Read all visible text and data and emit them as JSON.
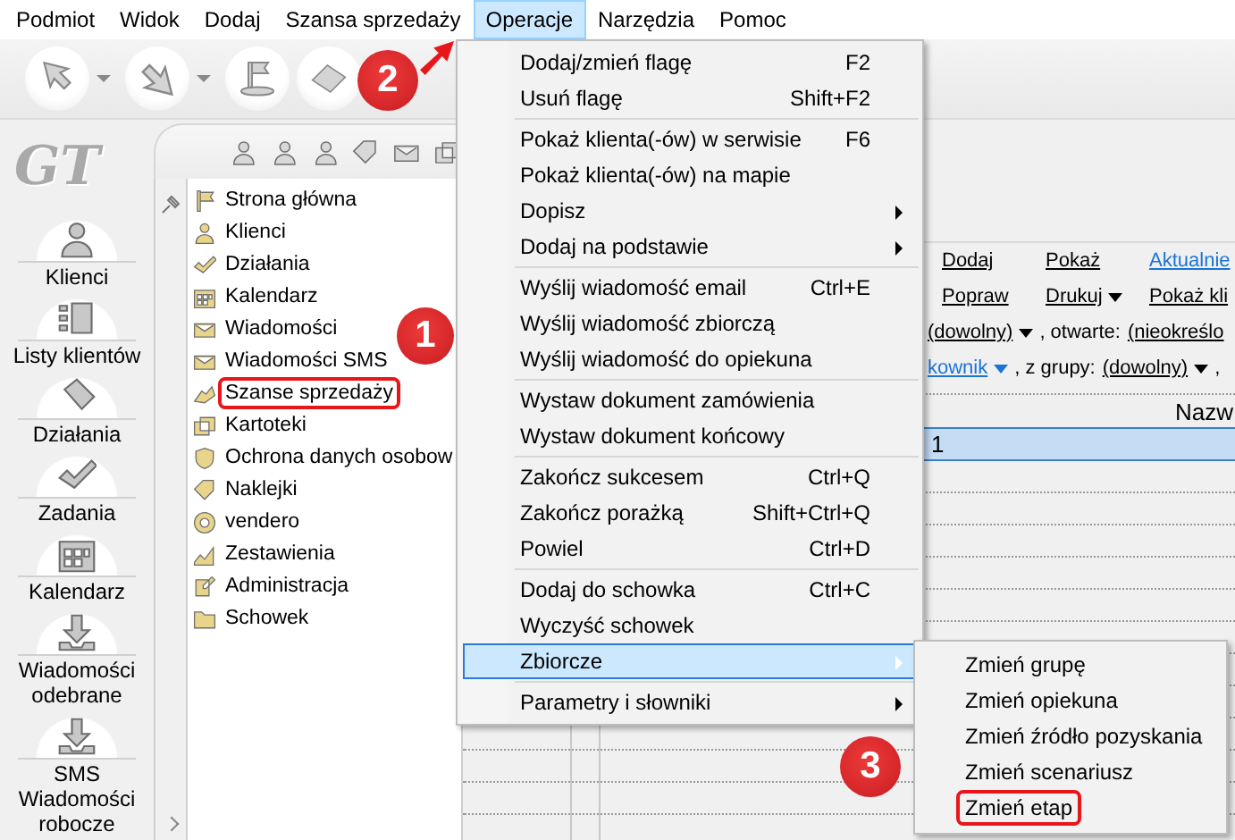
{
  "menubar": [
    {
      "label": "Podmiot",
      "selected": false
    },
    {
      "label": "Widok",
      "selected": false
    },
    {
      "label": "Dodaj",
      "selected": false
    },
    {
      "label": "Szansa sprzedaży",
      "selected": false
    },
    {
      "label": "Operacje",
      "selected": true
    },
    {
      "label": "Narzędzia",
      "selected": false
    },
    {
      "label": "Pomoc",
      "selected": false
    }
  ],
  "logo": "GT",
  "sidebar": [
    {
      "label": "Klienci"
    },
    {
      "label": "Listy klientów"
    },
    {
      "label": "Działania"
    },
    {
      "label": "Zadania"
    },
    {
      "label": "Kalendarz"
    },
    {
      "label": "Wiadomości odebrane"
    },
    {
      "label": "SMS Wiadomości robocze"
    }
  ],
  "tree": [
    {
      "label": "Strona główna",
      "marked": false
    },
    {
      "label": "Klienci",
      "marked": false
    },
    {
      "label": "Działania",
      "marked": false
    },
    {
      "label": "Kalendarz",
      "marked": false
    },
    {
      "label": "Wiadomości",
      "marked": false
    },
    {
      "label": "Wiadomości SMS",
      "marked": false
    },
    {
      "label": "Szanse sprzedaży",
      "marked": true
    },
    {
      "label": "Kartoteki",
      "marked": false
    },
    {
      "label": "Ochrona danych osobow",
      "marked": false
    },
    {
      "label": "Naklejki",
      "marked": false
    },
    {
      "label": "vendero",
      "marked": false
    },
    {
      "label": "Zestawienia",
      "marked": false
    },
    {
      "label": "Administracja",
      "marked": false
    },
    {
      "label": "Schowek",
      "marked": false
    }
  ],
  "content": {
    "rows": [
      [
        {
          "kind": "link",
          "label": "Dodaj"
        },
        {
          "kind": "link",
          "label": "Pokaż"
        },
        {
          "kind": "hyperlink",
          "label": "Aktualnie"
        }
      ],
      [
        {
          "kind": "link",
          "label": "Popraw"
        },
        {
          "kind": "dropdown",
          "label": "Drukuj"
        },
        {
          "kind": "link",
          "label": "Pokaż kli"
        }
      ],
      [
        {
          "kind": "dropdown",
          "label": "(dowolny)"
        },
        {
          "kind": "text",
          "label": ", otwarte:"
        },
        {
          "kind": "link",
          "label": "(nieokreślo"
        }
      ],
      [
        {
          "kind": "hyperdropdown",
          "label": "kownik"
        },
        {
          "kind": "text",
          "label": ", z grupy:"
        },
        {
          "kind": "dropdown",
          "label": "(dowolny)"
        },
        {
          "kind": "text",
          "label": ","
        }
      ]
    ],
    "table": {
      "header": "Nazw",
      "rows": [
        {
          "cell": "1",
          "selected": true
        }
      ]
    }
  },
  "menu": {
    "items": [
      {
        "kind": "item",
        "label": "Dodaj/zmień flagę",
        "shortcut": "F2",
        "submenu": false,
        "selected": false
      },
      {
        "kind": "item",
        "label": "Usuń flagę",
        "shortcut": "Shift+F2",
        "submenu": false,
        "selected": false
      },
      {
        "kind": "separator"
      },
      {
        "kind": "item",
        "label": "Pokaż klienta(-ów) w serwisie",
        "shortcut": "F6",
        "submenu": false,
        "selected": false
      },
      {
        "kind": "item",
        "label": "Pokaż klienta(-ów) na mapie",
        "submenu": false,
        "selected": false
      },
      {
        "kind": "item",
        "label": "Dopisz",
        "submenu": true,
        "selected": false
      },
      {
        "kind": "item",
        "label": "Dodaj na podstawie",
        "submenu": true,
        "selected": false
      },
      {
        "kind": "separator"
      },
      {
        "kind": "item",
        "label": "Wyślij wiadomość email",
        "shortcut": "Ctrl+E",
        "submenu": false,
        "selected": false
      },
      {
        "kind": "item",
        "label": "Wyślij wiadomość zbiorczą",
        "submenu": false,
        "selected": false
      },
      {
        "kind": "item",
        "label": "Wyślij wiadomość do opiekuna",
        "submenu": false,
        "selected": false
      },
      {
        "kind": "separator"
      },
      {
        "kind": "item",
        "label": "Wystaw dokument zamówienia",
        "submenu": false,
        "selected": false
      },
      {
        "kind": "item",
        "label": "Wystaw dokument końcowy",
        "submenu": false,
        "selected": false
      },
      {
        "kind": "separator"
      },
      {
        "kind": "item",
        "label": "Zakończ sukcesem",
        "shortcut": "Ctrl+Q",
        "submenu": false,
        "selected": false
      },
      {
        "kind": "item",
        "label": "Zakończ porażką",
        "shortcut": "Shift+Ctrl+Q",
        "submenu": false,
        "selected": false
      },
      {
        "kind": "item",
        "label": "Powiel",
        "shortcut": "Ctrl+D",
        "submenu": false,
        "selected": false
      },
      {
        "kind": "separator"
      },
      {
        "kind": "item",
        "label": "Dodaj do schowka",
        "shortcut": "Ctrl+C",
        "submenu": false,
        "selected": false
      },
      {
        "kind": "item",
        "label": "Wyczyść schowek",
        "submenu": false,
        "selected": false
      },
      {
        "kind": "item",
        "label": "Zbiorcze",
        "submenu": true,
        "selected": true
      },
      {
        "kind": "separator"
      },
      {
        "kind": "item",
        "label": "Parametry i słowniki",
        "submenu": true,
        "selected": false
      }
    ]
  },
  "submenu": {
    "items": [
      {
        "label": "Zmień grupę",
        "marked": false
      },
      {
        "label": "Zmień opiekuna",
        "marked": false
      },
      {
        "label": "Zmień źródło pozyskania",
        "marked": false
      },
      {
        "label": "Zmień scenariusz",
        "marked": false
      },
      {
        "label": "Zmień etap",
        "marked": true
      }
    ]
  },
  "callouts": [
    {
      "number": "1"
    },
    {
      "number": "2",
      "arrow": true
    },
    {
      "number": "3"
    }
  ]
}
